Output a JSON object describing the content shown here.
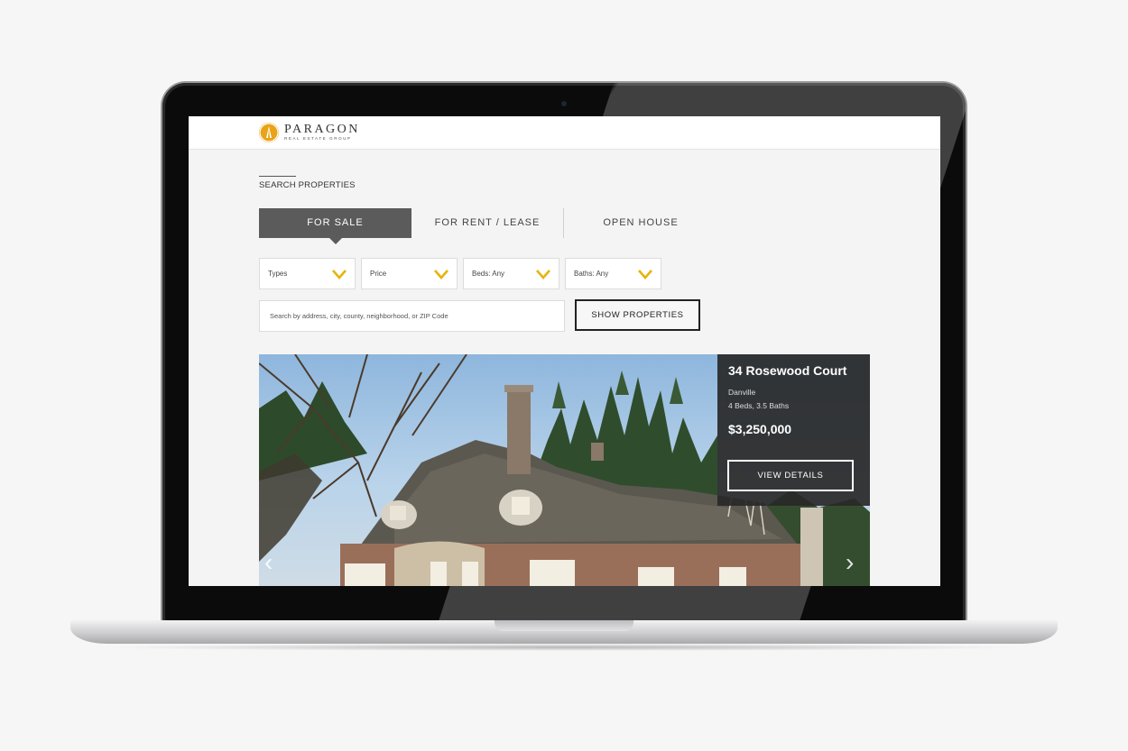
{
  "brand": {
    "name": "PARAGON",
    "tagline": "REAL ESTATE GROUP",
    "accent": "#e8a317"
  },
  "section": {
    "title": "SEARCH PROPERTIES"
  },
  "tabs": [
    {
      "label": "FOR SALE",
      "active": true
    },
    {
      "label": "FOR RENT / LEASE",
      "active": false
    },
    {
      "label": "OPEN HOUSE",
      "active": false
    }
  ],
  "filters": [
    {
      "label": "Types"
    },
    {
      "label": "Price"
    },
    {
      "label": "Beds: Any"
    },
    {
      "label": "Baths: Any"
    }
  ],
  "search": {
    "placeholder": "Search by address, city, county, neighborhood, or ZIP Code"
  },
  "show_button": {
    "label": "SHOW PROPERTIES"
  },
  "listing": {
    "address": "34 Rosewood Court",
    "city": "Danville",
    "beds_baths": "4 Beds, 3.5 Baths",
    "price": "$3,250,000",
    "details_label": "VIEW DETAILS",
    "prev_icon": "‹",
    "next_icon": "›"
  },
  "colors": {
    "tab_active": "#5b5b5b",
    "chevron": "#e8b40c",
    "info_panel": "#282828"
  }
}
